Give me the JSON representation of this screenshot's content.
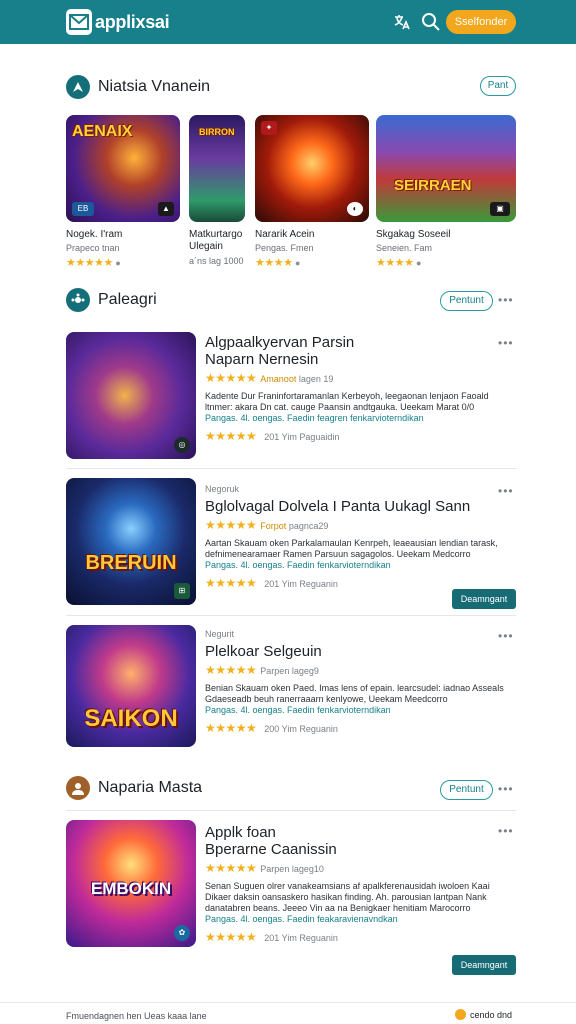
{
  "app": {
    "title": "applixsai",
    "action_button": "Sselfonder"
  },
  "sections": {
    "featured": {
      "title": "Niatsia Vnanein",
      "pill": "Pant"
    },
    "popular": {
      "title": "Paleagri",
      "pill": "Pentunt"
    },
    "more": {
      "title": "Naparia Masta",
      "pill": "Pentunt"
    }
  },
  "featured_cards": [
    {
      "art": "AENAIX",
      "name": "Nogek. I'ram",
      "sub": "Prapeco tnan",
      "stars": "★★★★★",
      "color": "#5a2fa0"
    },
    {
      "art": "BIRRON",
      "name": "Matkurtargo\nUlegain",
      "sub": "a´ns lag 1000",
      "stars": "",
      "color": "#3a2a7a"
    },
    {
      "art": "",
      "name": "Nararik Acein",
      "sub": "Pengas. Fmen",
      "stars": "★★★★",
      "color": "#7a1c10"
    },
    {
      "art": "SEIRRAEN",
      "name": "Skgakag Soseeil",
      "sub": "Seneien. Fam",
      "stars": "★★★★",
      "color": "#3a7a3a"
    }
  ],
  "list_items": [
    {
      "label": "",
      "title": "Algpaalkyervan Parsin\nNaparn Nernesin",
      "meta_hl": "Amanoot",
      "meta": "lagen 19",
      "desc": "Kadente Dur Franinfortaramanlan Kerbeyoh, leegaonan lenjaon Faoald ltnmer: akara Dn cat. cauge Paansin andtgauka. Ueekam Marat 0/0",
      "tags": "Pangas. 4l. oengas. Faedin feagren fenkarvioterndikan",
      "rating_line": "201 Yim Paguaidin",
      "big_art": "",
      "button": ""
    },
    {
      "label": "Negoruk",
      "title": "Bglolvagal Dolvela I Panta Uukagl Sann",
      "meta_hl": "Forpot",
      "meta": "pagnca29",
      "desc": "Aartan Skauam oken Parkalamaulan Kenrpeh, leaeausian lendian tarask, defnimenearamaer Ramen Parsuun sagagolos. Ueekam Medcorro",
      "tags": "Pangas. 4l. oengas. Faedin fenkarvioterndikan",
      "rating_line": "201 Yim Reguanin",
      "big_art": "BRERUIN",
      "button": "Deamngant"
    },
    {
      "label": "Negurit",
      "title": "Plelkoar Selgeuin",
      "meta_hl": "",
      "meta": "Parpen   lageg9",
      "desc": "Benian Skauam oken Paed. Imas lens of epain. learcsudel: iadnao Asseals Gdaeseadb beuh ranerraaarn kenlyowe, Ueekam Meedcorro",
      "tags": "Pangas. 4l. oengas. Faedin fenkarvioterndikan",
      "rating_line": "200 Yim Reguanin",
      "big_art": "SAIKON",
      "button": ""
    },
    {
      "label": "",
      "title": "Applk foan\nBperarne Caanissin",
      "meta_hl": "",
      "meta": "Parpen   lageg10",
      "desc": "Senan Suguen olrer vanakeamsians af apalkferenausidah iwoloen Kaai Dikaer daksin oansaskero hasikan finding. Ah. parousian lantpan Nank danatabren beans. Jeeeo Vin aa na Benigkaer henitiam Marocorro",
      "tags": "Pangas. 4l. oengas. Faedin feakaravienavndkan",
      "rating_line": "201 Yim Reguanin",
      "big_art": "EMBOKIN",
      "button": "Deamngant"
    }
  ],
  "footer": {
    "left": "Fmuendagnen hen Ueas kaaa lane",
    "right": "cendo dnd"
  },
  "colors": {
    "brand": "#17808a",
    "accent": "#f2a71c",
    "star": "#f2b01e"
  }
}
